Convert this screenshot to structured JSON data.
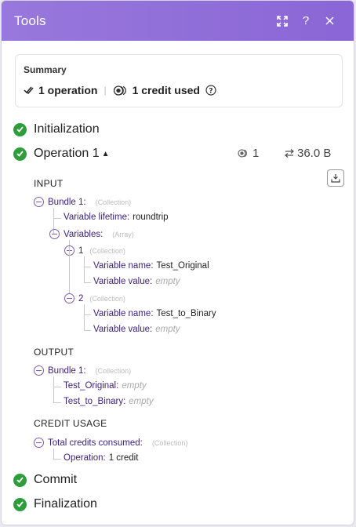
{
  "header": {
    "title": "Tools"
  },
  "summary": {
    "title": "Summary",
    "operations": "1 operation",
    "credits": "1 credit used"
  },
  "steps": {
    "initialization": "Initialization",
    "operation": "Operation 1",
    "commit": "Commit",
    "finalization": "Finalization"
  },
  "operation_metrics": {
    "credits": "1",
    "size": "36.0 B"
  },
  "input": {
    "label": "INPUT",
    "bundle": {
      "key": "Bundle 1",
      "type": "(Collection)"
    },
    "variable_lifetime": {
      "key": "Variable lifetime",
      "value": "roundtrip"
    },
    "variables": {
      "key": "Variables",
      "type": "(Array)"
    },
    "item1": {
      "key": "1",
      "type": "(Collection)"
    },
    "item1_name": {
      "key": "Variable name",
      "value": "Test_Original"
    },
    "item1_value": {
      "key": "Variable value",
      "value": "empty"
    },
    "item2": {
      "key": "2",
      "type": "(Collection)"
    },
    "item2_name": {
      "key": "Variable name",
      "value": "Test_to_Binary"
    },
    "item2_value": {
      "key": "Variable value",
      "value": "empty"
    }
  },
  "output": {
    "label": "OUTPUT",
    "bundle": {
      "key": "Bundle 1",
      "type": "(Collection)"
    },
    "test_original": {
      "key": "Test_Original",
      "value": "empty"
    },
    "test_to_binary": {
      "key": "Test_to_Binary",
      "value": "empty"
    }
  },
  "credit_usage": {
    "label": "CREDIT USAGE",
    "total": {
      "key": "Total credits consumed",
      "type": "(Collection)"
    },
    "operation": {
      "key": "Operation",
      "value": "1 credit"
    }
  },
  "colors": {
    "header": "#8a66d6",
    "success": "#2e9e3c",
    "key": "#3b1e7a"
  }
}
